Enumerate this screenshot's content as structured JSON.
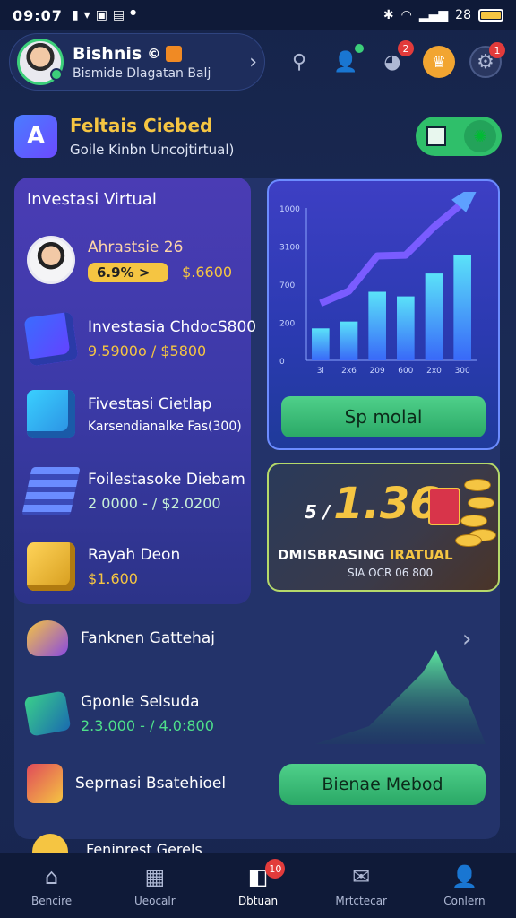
{
  "status_bar": {
    "time": "09:07",
    "battery_label": "28"
  },
  "header": {
    "profile_name": "Bishnis",
    "profile_sub": "Bismide Dlagatan Balj",
    "notif_counts": [
      "2",
      "1"
    ]
  },
  "banner": {
    "title": "Feltais Ciebed",
    "subtitle": "Goile Kinbn Uncojtirtual)"
  },
  "investasi": {
    "title": "Investasi Virtual",
    "items": [
      {
        "name": "Ahrastsie 26",
        "pill": "6.9% >",
        "value": "$.6600"
      },
      {
        "name": "Investasia ChdocS800",
        "value": "9.5900o / $5800"
      },
      {
        "name": "Fivestasi Cietlap",
        "value": "Karsendianalke Fas(300)"
      },
      {
        "name": "Foilestasoke Diebam",
        "value": "2 0000 - / $2.0200"
      },
      {
        "name": "Rayah Deon",
        "value": "$1.600"
      }
    ]
  },
  "chart_data": {
    "type": "bar",
    "title": "",
    "yticks": [
      "1000",
      "3100",
      "700",
      "200",
      "0"
    ],
    "categories": [
      "3l",
      "2x6",
      "209",
      "600",
      "2x0",
      "300"
    ],
    "values": [
      0.14,
      0.17,
      0.3,
      0.28,
      0.38,
      0.46
    ],
    "trend": "rising arrow"
  },
  "chart_card": {
    "button_label": "Sp molal"
  },
  "promo": {
    "prefix": "5 /",
    "big": "1.36",
    "label": "DMISBRASING",
    "label_highlight": " IRATUAL",
    "sub": "SIA OCR 06 800"
  },
  "lower_list": [
    {
      "name": "Fanknen Gattehaj"
    },
    {
      "name": "Gponle Selsuda",
      "value": "2.3.000 - / 4.0:800"
    },
    {
      "name": "Seprnasi Bsatehioel"
    },
    {
      "name": "Fenjnrest Gerels"
    }
  ],
  "lower_button": {
    "label": "Bienae Mebod"
  },
  "bottom_nav": {
    "items": [
      {
        "label": "Bencire",
        "icon": "home-icon"
      },
      {
        "label": "Ueocalr",
        "icon": "calendar-icon"
      },
      {
        "label": "Dbtuan",
        "icon": "wallet-icon",
        "badge": "10"
      },
      {
        "label": "Mrtctecar",
        "icon": "mail-icon"
      },
      {
        "label": "Conlern",
        "icon": "user-icon"
      }
    ]
  },
  "colors": {
    "accent_green": "#2fbf6a",
    "accent_gold": "#f5c542",
    "panel": "#23336a"
  }
}
